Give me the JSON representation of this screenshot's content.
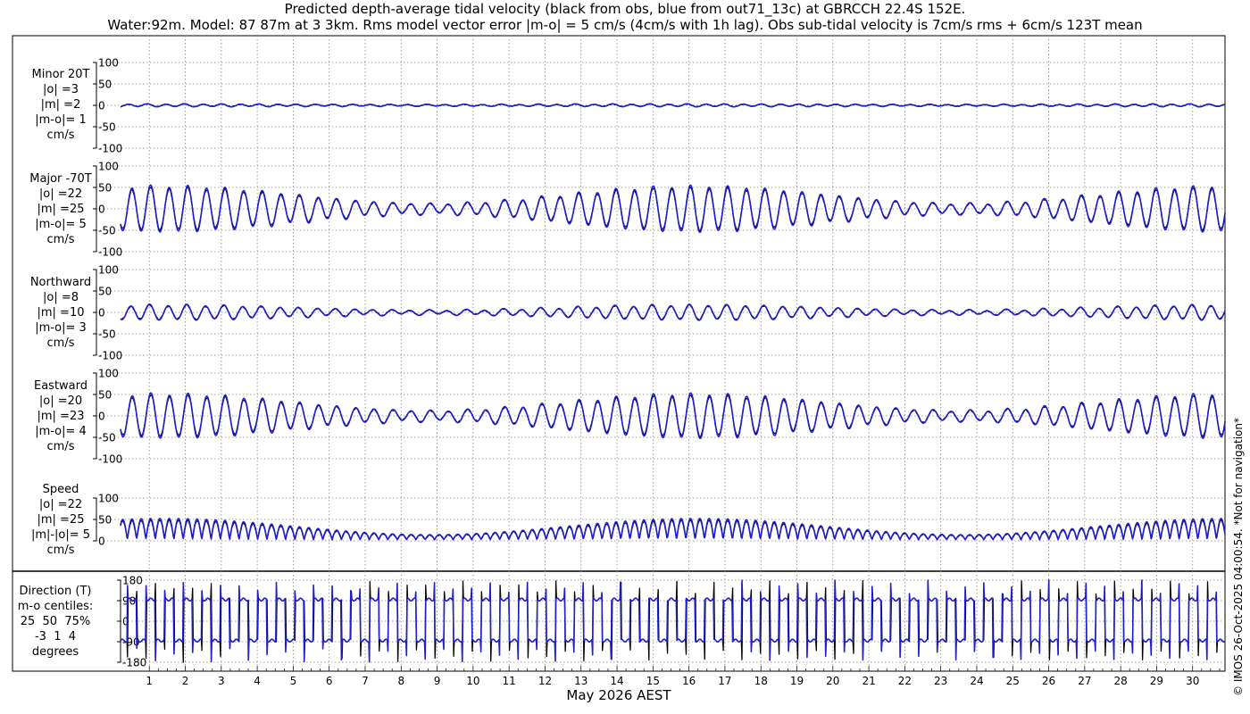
{
  "header": {
    "title_line1": "Predicted depth-average tidal velocity (black from obs, blue from out71_13c) at GBRCCH 22.4S 152E.",
    "title_line2": "Water:92m. Model: 87 87m at 3 3km. Rms model vector error |m-o| = 5 cm/s (4cm/s with 1h lag). Obs sub-tidal velocity is 7cm/s rms + 6cm/s 123T mean"
  },
  "panels": [
    {
      "label": "Minor 20T\n|o| =3\n|m| =2\n|m-o|= 1\ncm/s"
    },
    {
      "label": "Major -70T\n|o| =22\n|m| =25\n|m-o|= 5\ncm/s"
    },
    {
      "label": "Northward\n|o| =8\n|m| =10\n|m-o|= 3\ncm/s"
    },
    {
      "label": "Eastward\n|o| =20\n|m| =23\n|m-o|= 4\ncm/s"
    },
    {
      "label": "Speed\n|o| =22\n|m| =25\n|m|-|o|= 5\ncm/s"
    }
  ],
  "direction_panel": {
    "label": "Direction (T)\nm-o centiles:\n25  50  75%\n-3  1  4\ndegrees"
  },
  "copyright": "© IMOS 26-Oct-2025 04:00:54. *Not for navigation*",
  "colors": {
    "obs": "#000000",
    "model": "#1f1fd0",
    "grid": "#888888"
  },
  "chart_data": {
    "type": "line",
    "xlabel": "May 2026 AEST",
    "x_ticks": [
      "1",
      "2",
      "3",
      "4",
      "5",
      "6",
      "7",
      "8",
      "9",
      "10",
      "11",
      "12",
      "13",
      "14",
      "15",
      "16",
      "17",
      "18",
      "19",
      "20",
      "21",
      "22",
      "23",
      "24",
      "25",
      "26",
      "27",
      "28",
      "29",
      "30"
    ],
    "x_range_days": [
      0.2,
      30.9
    ],
    "series_names": [
      "obs (black)",
      "model (blue)"
    ],
    "subplots": [
      {
        "name": "Minor 20T",
        "units": "cm/s",
        "ylim": [
          -100,
          100
        ],
        "yticks": [
          "100",
          "50",
          "0",
          "-50",
          "-100"
        ],
        "amplitude_min": 2,
        "amplitude_max": 3
      },
      {
        "name": "Major -70T",
        "units": "cm/s",
        "ylim": [
          -100,
          100
        ],
        "yticks": [
          "100",
          "50",
          "0",
          "-50",
          "-100"
        ],
        "amplitude_min": 12,
        "amplitude_max": 52
      },
      {
        "name": "Northward",
        "units": "cm/s",
        "ylim": [
          -100,
          100
        ],
        "yticks": [
          "100",
          "50",
          "0",
          "-50",
          "-100"
        ],
        "amplitude_min": 5,
        "amplitude_max": 17
      },
      {
        "name": "Eastward",
        "units": "cm/s",
        "ylim": [
          -100,
          100
        ],
        "yticks": [
          "100",
          "50",
          "0",
          "-50",
          "-100"
        ],
        "amplitude_min": 12,
        "amplitude_max": 50
      },
      {
        "name": "Speed",
        "units": "cm/s",
        "ylim": [
          0,
          100
        ],
        "yticks": [
          "100",
          "50",
          "0"
        ],
        "amplitude_min": 12,
        "amplitude_max": 52
      },
      {
        "name": "Direction (T)",
        "units": "degrees",
        "ylim": [
          -180,
          180
        ],
        "yticks": [
          "180",
          "90",
          "0",
          "-90",
          "-180"
        ],
        "plateaus": [
          95,
          -85
        ]
      }
    ]
  }
}
